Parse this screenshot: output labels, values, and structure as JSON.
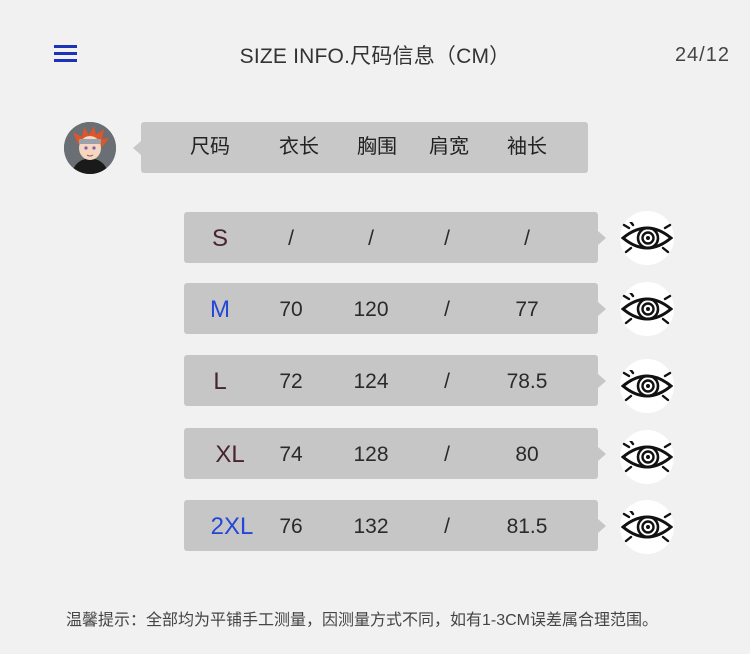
{
  "header": {
    "title": "SIZE INFO.尺码信息（CM）",
    "page": "24/12"
  },
  "columns": [
    "尺码",
    "衣长",
    "胸围",
    "肩宽",
    "袖长"
  ],
  "rows": [
    {
      "size": "S",
      "size_color": "#4a2330",
      "length": "/",
      "chest": "/",
      "shoulder": "/",
      "sleeve": "/"
    },
    {
      "size": "M",
      "size_color": "#2447d8",
      "length": "70",
      "chest": "120",
      "shoulder": "/",
      "sleeve": "77"
    },
    {
      "size": "L",
      "size_color": "#4a2330",
      "length": "72",
      "chest": "124",
      "shoulder": "/",
      "sleeve": "78.5"
    },
    {
      "size": "XL",
      "size_color": "#4a2330",
      "length": "74",
      "chest": "128",
      "shoulder": "/",
      "sleeve": "80"
    },
    {
      "size": "2XL",
      "size_color": "#2447d8",
      "length": "76",
      "chest": "132",
      "shoulder": "/",
      "sleeve": "81.5"
    }
  ],
  "note": "温馨提示：全部均为平铺手工测量，因测量方式不同，如有1-3CM误差属合理范围。",
  "colors": {
    "accent": "#1c33b8",
    "bubble": "#c6c6c6",
    "background": "#f1f1f1"
  },
  "icons": {
    "menu": "menu-icon",
    "avatar": "avatar",
    "eye": "rinnegan-eye-icon"
  }
}
